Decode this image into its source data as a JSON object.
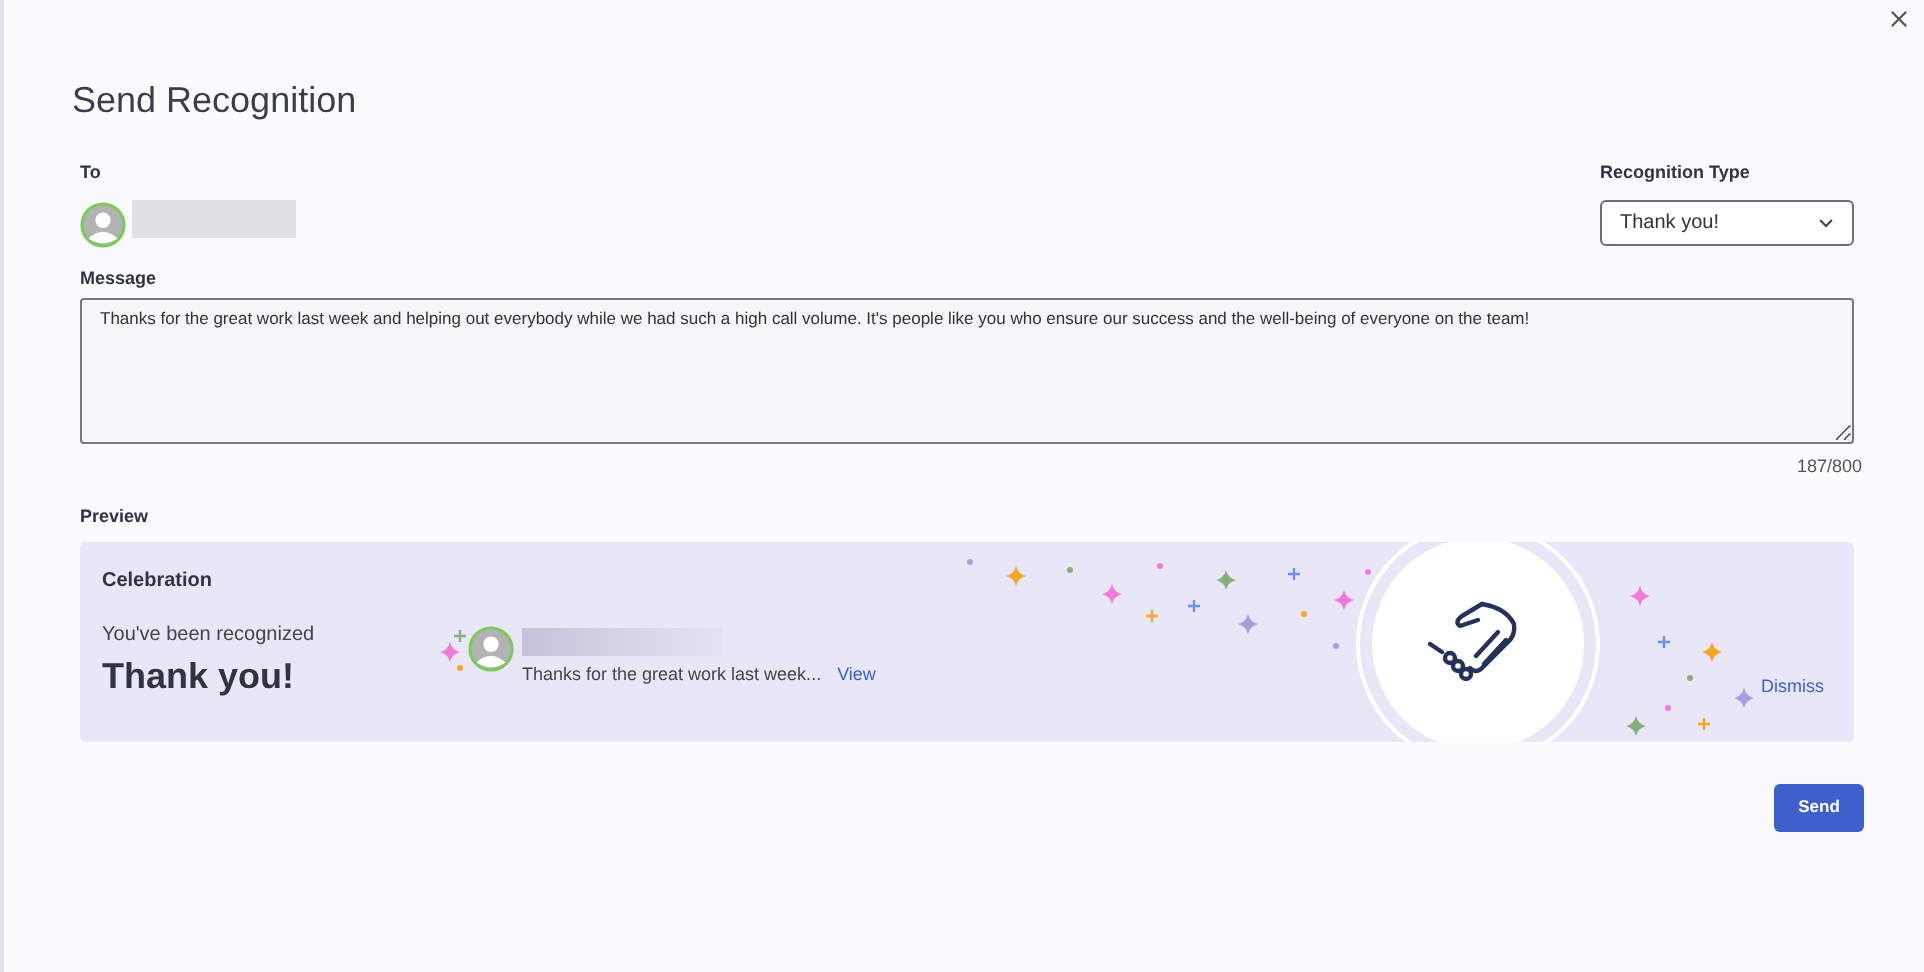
{
  "dialog": {
    "title": "Send Recognition"
  },
  "to": {
    "label": "To"
  },
  "recognition_type": {
    "label": "Recognition Type",
    "value": "Thank you!"
  },
  "message": {
    "label": "Message",
    "value": "Thanks for the great work last week and helping out everybody while we had such a high call volume. It's people like you who ensure our success and the well-being of everyone on the team!",
    "counter": "187/800"
  },
  "preview": {
    "label": "Preview",
    "heading": "Celebration",
    "subtitle": "You've been recognized",
    "type": "Thank you!",
    "snippet": "Thanks for the great work last week...",
    "view_link": "View",
    "dismiss": "Dismiss"
  },
  "send_button": "Send"
}
